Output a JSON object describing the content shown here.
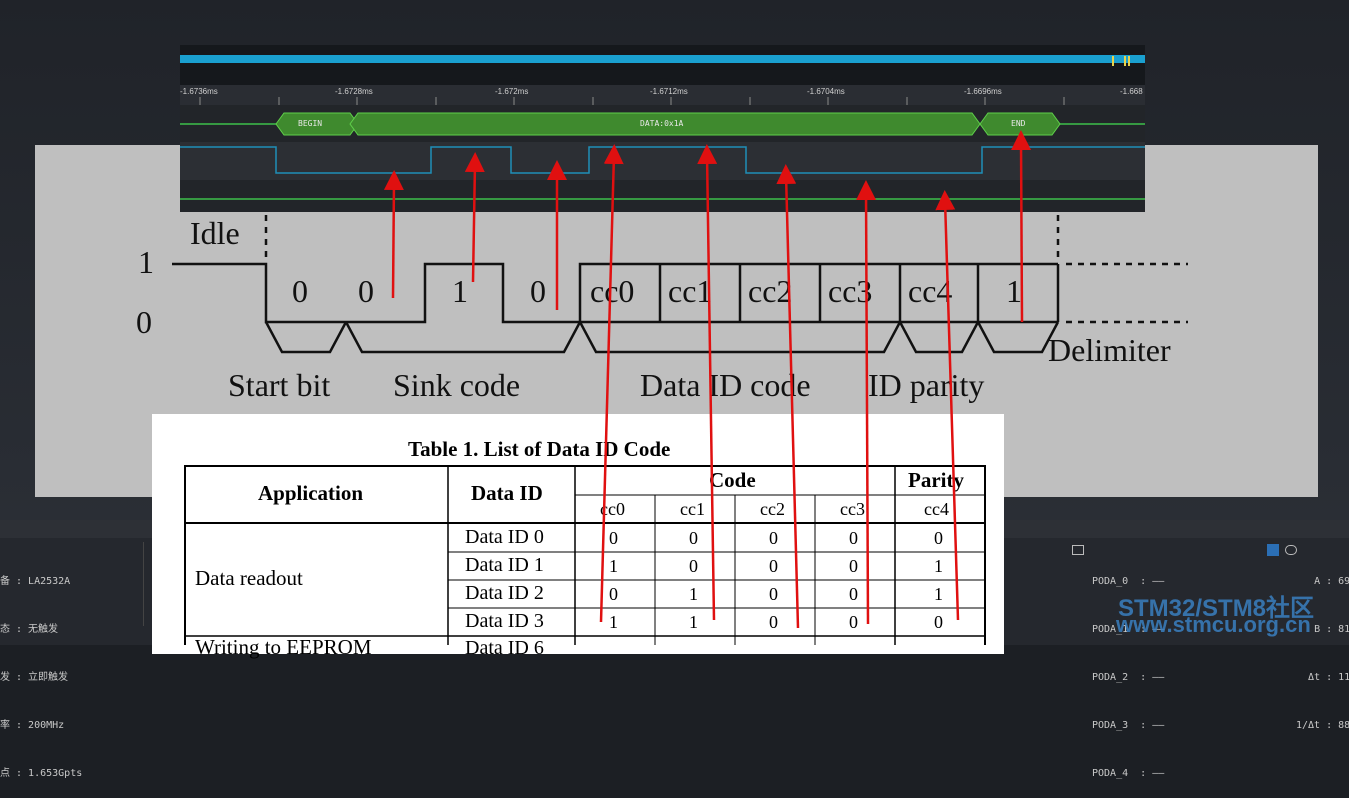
{
  "device_panel": {
    "line1": "备 : LA2532A",
    "line2": "态 : 无触发",
    "line3": "发 : 立即触发",
    "line4": "率 : 200MHz",
    "line5": "点 : 1.653Gpts"
  },
  "channel_panel": {
    "ch0": "PODA_0  : ——",
    "ch1": "PODA_1  : ——",
    "ch2": "PODA_2  : ——",
    "ch3": "PODA_3  : ——",
    "ch4": "PODA_4  : ——"
  },
  "cursor_panel": {
    "a": "A : 69.",
    "b": "B : 81.",
    "dt": "Δt : 11.",
    "inv": "1/Δt : 88."
  },
  "timeline": {
    "ticks": [
      "-1.6736ms",
      "-1.6728ms",
      "-1.672ms",
      "-1.6712ms",
      "-1.6704ms",
      "-1.6696ms",
      "-1.668"
    ]
  },
  "protocol": {
    "begin": "BEGIN",
    "data": "DATA:0x1A",
    "end": "END"
  },
  "diagram": {
    "idle": "Idle",
    "level_high": "1",
    "level_low": "0",
    "bits": [
      "0",
      "0",
      "1",
      "0",
      "cc0",
      "cc1",
      "cc2",
      "cc3",
      "cc4",
      "1"
    ],
    "start_bit": "Start bit",
    "sink_code": "Sink code",
    "data_id_code": "Data ID code",
    "id_parity": "ID parity",
    "delimiter": "Delimiter"
  },
  "table": {
    "title": "Table 1. List of Data ID Code",
    "h_application": "Application",
    "h_data_id": "Data ID",
    "h_code": "Code",
    "h_parity": "Parity",
    "subheaders": [
      "cc0",
      "cc1",
      "cc2",
      "cc3",
      "cc4"
    ],
    "group1": "Data readout",
    "rows": [
      {
        "id": "Data ID 0",
        "cells": [
          "0",
          "0",
          "0",
          "0",
          "0"
        ]
      },
      {
        "id": "Data ID 1",
        "cells": [
          "1",
          "0",
          "0",
          "0",
          "1"
        ]
      },
      {
        "id": "Data ID 2",
        "cells": [
          "0",
          "1",
          "0",
          "0",
          "1"
        ]
      },
      {
        "id": "Data ID 3",
        "cells": [
          "1",
          "1",
          "0",
          "0",
          "0"
        ]
      }
    ],
    "group2_partial": "Writing to EEPROM",
    "row5_partial": "Data ID 6"
  },
  "watermark": {
    "line1": "STM32/STM8社区",
    "line2": "www.stmcu.org.cn"
  },
  "colors": {
    "arrow": "#e01010",
    "bus_fill": "#3f8a2e",
    "signal": "#1e8fb8"
  }
}
